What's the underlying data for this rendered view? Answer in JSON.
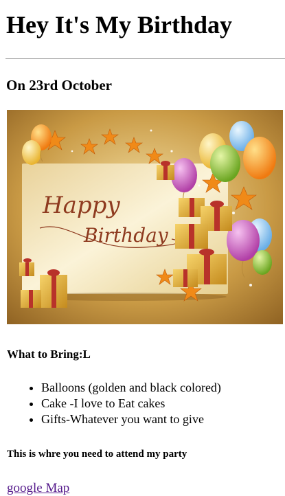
{
  "header": {
    "title": "Hey It's My Birthday"
  },
  "date": {
    "text": "On 23rd October"
  },
  "card": {
    "greeting_line1": "Happy",
    "greeting_line2": "Birthday",
    "colors": {
      "gold": "#d4a843",
      "cream": "#f7edc9",
      "red": "#b8322a",
      "orange": "#f39a1c",
      "pink": "#d66ac6",
      "blue": "#8ec9f0",
      "green": "#9acb3c"
    }
  },
  "bring": {
    "heading": "What to Bring:L",
    "items": [
      "Balloons (golden and black colored)",
      "Cake -I love to Eat cakes",
      "Gifts-Whatever you want to give"
    ]
  },
  "attend": {
    "text": "This is whre you need to attend my party"
  },
  "map_link": {
    "label": "google Map"
  }
}
